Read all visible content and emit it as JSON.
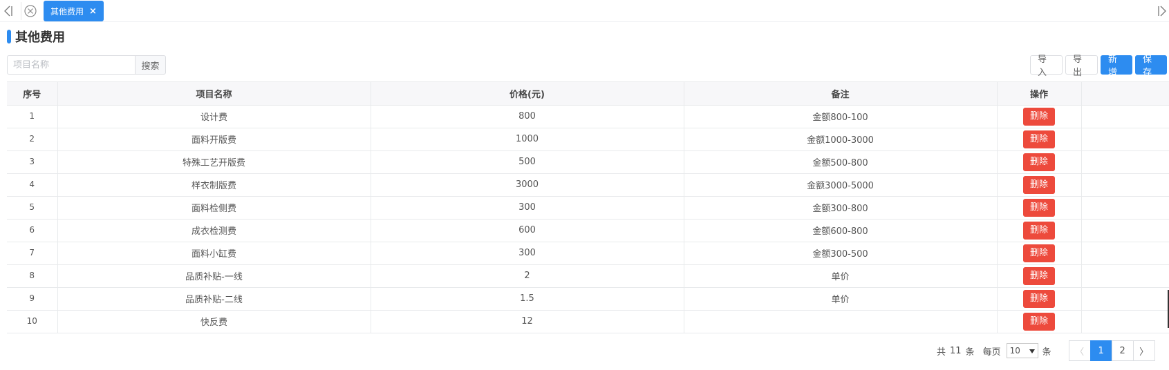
{
  "tabs": {
    "active_label": "其他费用",
    "close_glyph": "×"
  },
  "page": {
    "title": "其他费用"
  },
  "search": {
    "placeholder": "项目名称",
    "value": "",
    "button_label": "搜索"
  },
  "toolbar": {
    "import_label": "导入",
    "export_label": "导出",
    "add_label": "新增",
    "save_label": "保存"
  },
  "table": {
    "columns": [
      "序号",
      "项目名称",
      "价格(元)",
      "备注",
      "操作"
    ],
    "rows": [
      {
        "seq": "1",
        "name": "设计费",
        "price": "800",
        "note": "金额800-100",
        "action": "删除"
      },
      {
        "seq": "2",
        "name": "面料开版费",
        "price": "1000",
        "note": "金额1000-3000",
        "action": "删除"
      },
      {
        "seq": "3",
        "name": "特殊工艺开版费",
        "price": "500",
        "note": "金额500-800",
        "action": "删除"
      },
      {
        "seq": "4",
        "name": "样衣制版费",
        "price": "3000",
        "note": "金额3000-5000",
        "action": "删除"
      },
      {
        "seq": "5",
        "name": "面料检侧费",
        "price": "300",
        "note": "金额300-800",
        "action": "删除"
      },
      {
        "seq": "6",
        "name": "成衣检测费",
        "price": "600",
        "note": "金额600-800",
        "action": "删除"
      },
      {
        "seq": "7",
        "name": "面料小缸费",
        "price": "300",
        "note": "金额300-500",
        "action": "删除"
      },
      {
        "seq": "8",
        "name": "品质补贴-一线",
        "price": "2",
        "note": "单价",
        "action": "删除"
      },
      {
        "seq": "9",
        "name": "品质补贴-二线",
        "price": "1.5",
        "note": "单价",
        "action": "删除"
      },
      {
        "seq": "10",
        "name": "快反费",
        "price": "12",
        "note": "",
        "action": "删除"
      }
    ]
  },
  "pagination": {
    "total_prefix": "共",
    "total_count": "11",
    "total_suffix": "条",
    "per_page_label": "每页",
    "per_page_value": "10",
    "per_page_suffix": "条",
    "prev_glyph": "〈",
    "next_glyph": "〉",
    "pages": [
      "1",
      "2"
    ],
    "current_page": "1"
  },
  "colors": {
    "primary": "#2d8cf0",
    "danger": "#ed4a3c"
  },
  "icons": {
    "tab_left": "collapse-left-icon",
    "close_all": "close-circle-icon",
    "tab_right": "collapse-right-icon",
    "select_caret": "caret-down-icon"
  }
}
